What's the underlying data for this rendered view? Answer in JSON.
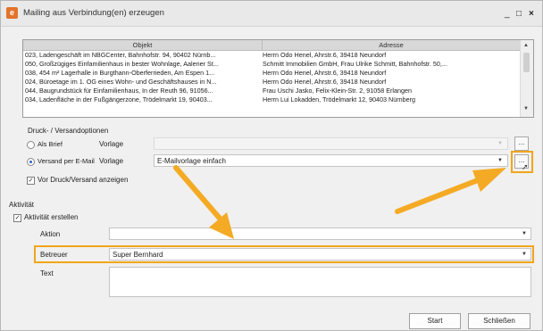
{
  "window": {
    "title": "Mailing aus Verbindung(en) erzeugen",
    "minimize": "_",
    "maximize": "□",
    "close": "×"
  },
  "table": {
    "columns": [
      "Objekt",
      "Adresse"
    ],
    "rows": [
      {
        "objekt": "023, Ladengeschäft im NBGCenter, Bahnhofstr. 94, 90402 Nürnb...",
        "adresse": "Herrn Odo Henel, Ahrstr.6, 39418 Neundorf"
      },
      {
        "objekt": "050, Großzügiges Einfamilienhaus in bester Wohnlage, Aalener St...",
        "adresse": "Schmitt Immobilien GmbH, Frau Ulrike Schmitt, Bahnhofstr. 50,..."
      },
      {
        "objekt": "038, 454 m² Lagerhalle in Burgthann-Oberferrieden, Am Espen 1...",
        "adresse": "Herrn Odo Henel, Ahrstr.6, 39418 Neundorf"
      },
      {
        "objekt": "024, Büroetage im 1. OG eines Wohn- und Geschäftshauses in N...",
        "adresse": "Herrn Odo Henel, Ahrstr.6, 39418 Neundorf"
      },
      {
        "objekt": "044, Baugrundstück für Einfamilienhaus, In der Reuth 96, 91056...",
        "adresse": "Frau Uschi Jasko, Felix-Klein-Str. 2, 91058 Erlangen"
      },
      {
        "objekt": "034, Ladenfläche in der Fußgängerzone, Trödelmarkt 19, 90403...",
        "adresse": "Herrn Lui Lokadden, Trödelmarkt 12, 90403 Nürnberg"
      }
    ]
  },
  "druck": {
    "section_label": "Druck- / Versandoptionen",
    "brief_label": "Als Brief",
    "email_label": "Versand per E-Mail",
    "vorlage_label": "Vorlage",
    "brief_vorlage_value": "",
    "email_vorlage_value": "E-Mailvorlage einfach",
    "browse_label": "...",
    "selected": "email",
    "anzeigen_label": "Vor Druck/Versand anzeigen",
    "anzeigen_checked": true
  },
  "aktivitaet": {
    "section_label": "Aktivität",
    "erstellen_label": "Aktivität erstellen",
    "erstellen_checked": true,
    "aktion_label": "Aktion",
    "aktion_value": "",
    "betreuer_label": "Betreuer",
    "betreuer_value": "Super Bernhard",
    "text_label": "Text",
    "text_value": ""
  },
  "buttons": {
    "start": "Start",
    "close": "Schließen"
  },
  "colors": {
    "highlight": "#f2a51a",
    "arrow": "#f4aa24",
    "app_icon": "#e3722b",
    "selected_radio": "#2a63c7"
  }
}
